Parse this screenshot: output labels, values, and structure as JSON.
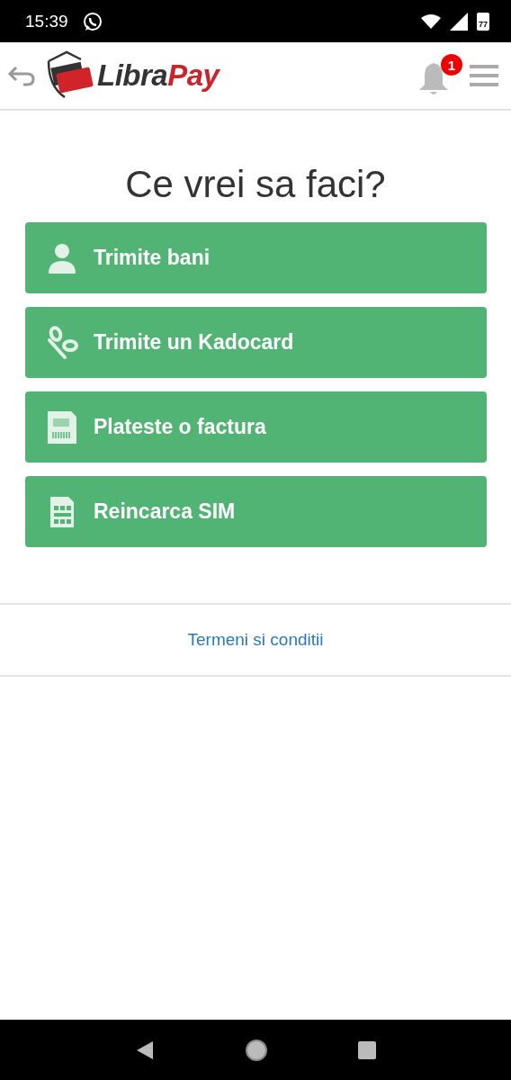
{
  "status_bar": {
    "time": "15:39",
    "battery_text": "77"
  },
  "header": {
    "logo_part_1": "Libra",
    "logo_part_2": "Pay",
    "notification_count": "1"
  },
  "heading": "Ce vrei sa faci?",
  "actions": [
    {
      "label": "Trimite bani",
      "kind": "person"
    },
    {
      "label": "Trimite un Kadocard",
      "kind": "gift"
    },
    {
      "label": "Plateste o factura",
      "kind": "invoice"
    },
    {
      "label": "Reincarca SIM",
      "kind": "sim"
    }
  ],
  "footer_link": "Termeni si conditii"
}
